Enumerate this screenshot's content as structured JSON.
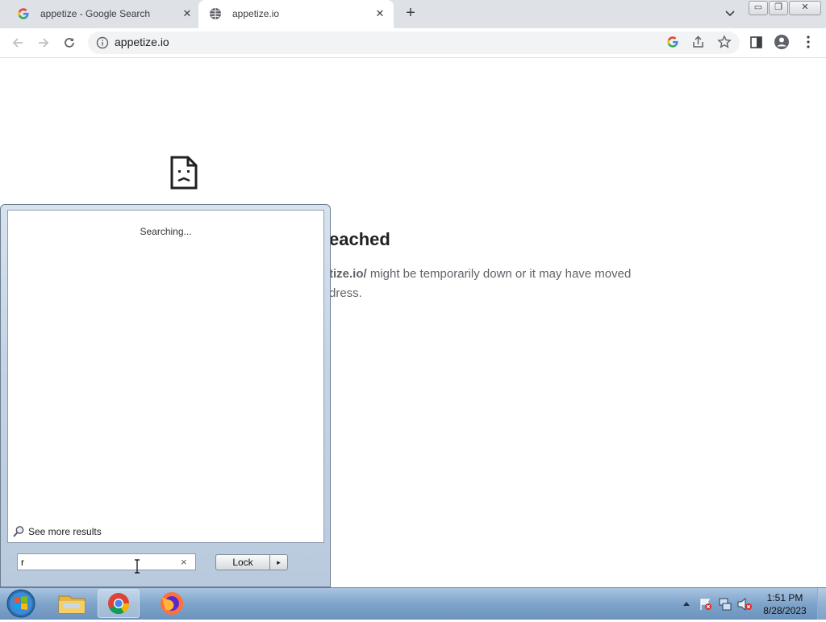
{
  "browser": {
    "tabs": [
      {
        "title": "appetize - Google Search",
        "active": false,
        "favicon": "google-icon"
      },
      {
        "title": "appetize.io",
        "active": true,
        "favicon": "globe-icon"
      }
    ],
    "address": "appetize.io",
    "icons": {
      "back": "back-arrow-icon",
      "forward": "forward-arrow-icon",
      "reload": "reload-icon",
      "site_info": "info-icon",
      "google_lens": "google-icon",
      "share": "share-icon",
      "bookmark": "star-icon",
      "sidepanel": "side-panel-icon",
      "profile": "profile-icon",
      "menu": "kebab-menu-icon"
    }
  },
  "error_page": {
    "title_visible": "eached",
    "desc_line1_bold": "tize.io/",
    "desc_line1_rest": " might be temporarily down or it may have moved",
    "desc_line2": "dress."
  },
  "start_menu": {
    "status": "Searching...",
    "see_more": "See more results",
    "search_value": "r",
    "clear_glyph": "×",
    "lock_label": "Lock",
    "lock_arrow_glyph": "▸"
  },
  "taskbar": {
    "time": "1:51 PM",
    "date": "8/28/2023",
    "items": [
      "start-orb-icon",
      "file-explorer-icon",
      "chrome-icon",
      "firefox-icon"
    ],
    "tray": [
      "show-hidden-icons-icon",
      "action-center-flag-icon",
      "network-icon",
      "volume-muted-icon"
    ]
  },
  "colors": {
    "tabstrip": "#dee1e6",
    "taskbar": "#7fa4cb",
    "startmenu": "#c5d4e5"
  }
}
